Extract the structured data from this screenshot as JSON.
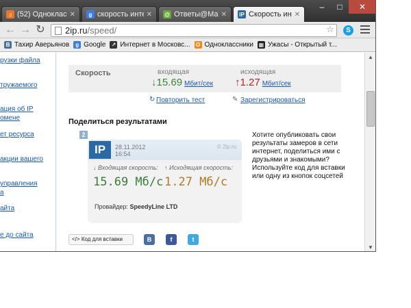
{
  "tabs": [
    {
      "title": "(52) Одноклассни",
      "icon": "music-icon",
      "color": "#e8762b"
    },
    {
      "title": "скорость интерне",
      "icon": "google-icon",
      "color": "#3e7de0"
    },
    {
      "title": "Ответы@Mail.Ru",
      "icon": "mailru-answers-icon",
      "color": "#6aa632"
    },
    {
      "title": "Скорость интерн",
      "icon": "2ip-icon",
      "color": "#2a69a3"
    }
  ],
  "toolbar": {
    "url_host": "2ip.ru",
    "url_path": "/speed/"
  },
  "bookmarks": [
    {
      "label": "Тахир Аверьянов",
      "icon": "vk-icon",
      "color": "#4a6f9d",
      "glyph": "В"
    },
    {
      "label": "Google",
      "icon": "google-icon",
      "color": "#3e7de0",
      "glyph": "g"
    },
    {
      "label": "Интернет в Московс...",
      "icon": "site-icon",
      "color": "#333333",
      "glyph": "↗"
    },
    {
      "label": "Одноклассники",
      "icon": "odnoklassniki-icon",
      "color": "#f28a1f",
      "glyph": "О"
    },
    {
      "label": "Ужасы - Открытый т...",
      "icon": "film-icon",
      "color": "#222222",
      "glyph": "▦"
    }
  ],
  "left_nav": [
    "рузки файла",
    "тружаемого",
    "ация об IP",
    "омене",
    "ет ресурса",
    "акции вашего",
    "управления",
    "а",
    "айта",
    "е до сайта"
  ],
  "speed": {
    "label": "Скорость",
    "incoming_label": "входящая",
    "outgoing_label": "исходящая",
    "incoming_value": "15.69",
    "outgoing_value": "1.27",
    "incoming_arrow": "↓",
    "outgoing_arrow": "↑",
    "unit": "Мбит/сек"
  },
  "actions": {
    "retest": "Повторить тест",
    "register": "Зарегистрироваться"
  },
  "share": {
    "title": "Поделиться результатами",
    "number": "2",
    "description": "Хотите опубликовать свои результаты замеров в сети интернет, поделиться ими с друзьями и знакомыми? Используйте код для вставки или одну из кнопок соцсетей",
    "code_button": "Код для вставки"
  },
  "card": {
    "logo": "IP",
    "date": "28.11.2012",
    "time": "16:54",
    "watermark": "© 2ip.ru",
    "incoming_label": "↓ Входящая скорость:",
    "outgoing_label": "↑ Исходящая скорость:",
    "incoming_speed": "15.69 Мб/с",
    "outgoing_speed": "1.27 Мб/с",
    "provider_label": "Провайдер:",
    "provider_name": "SpeedyLine LTD"
  },
  "social": [
    {
      "name": "vk",
      "glyph": "B",
      "color": "#4a6f9d"
    },
    {
      "name": "facebook",
      "glyph": "f",
      "color": "#3b5998"
    },
    {
      "name": "twitter",
      "glyph": "t",
      "color": "#3fa9e0"
    }
  ]
}
